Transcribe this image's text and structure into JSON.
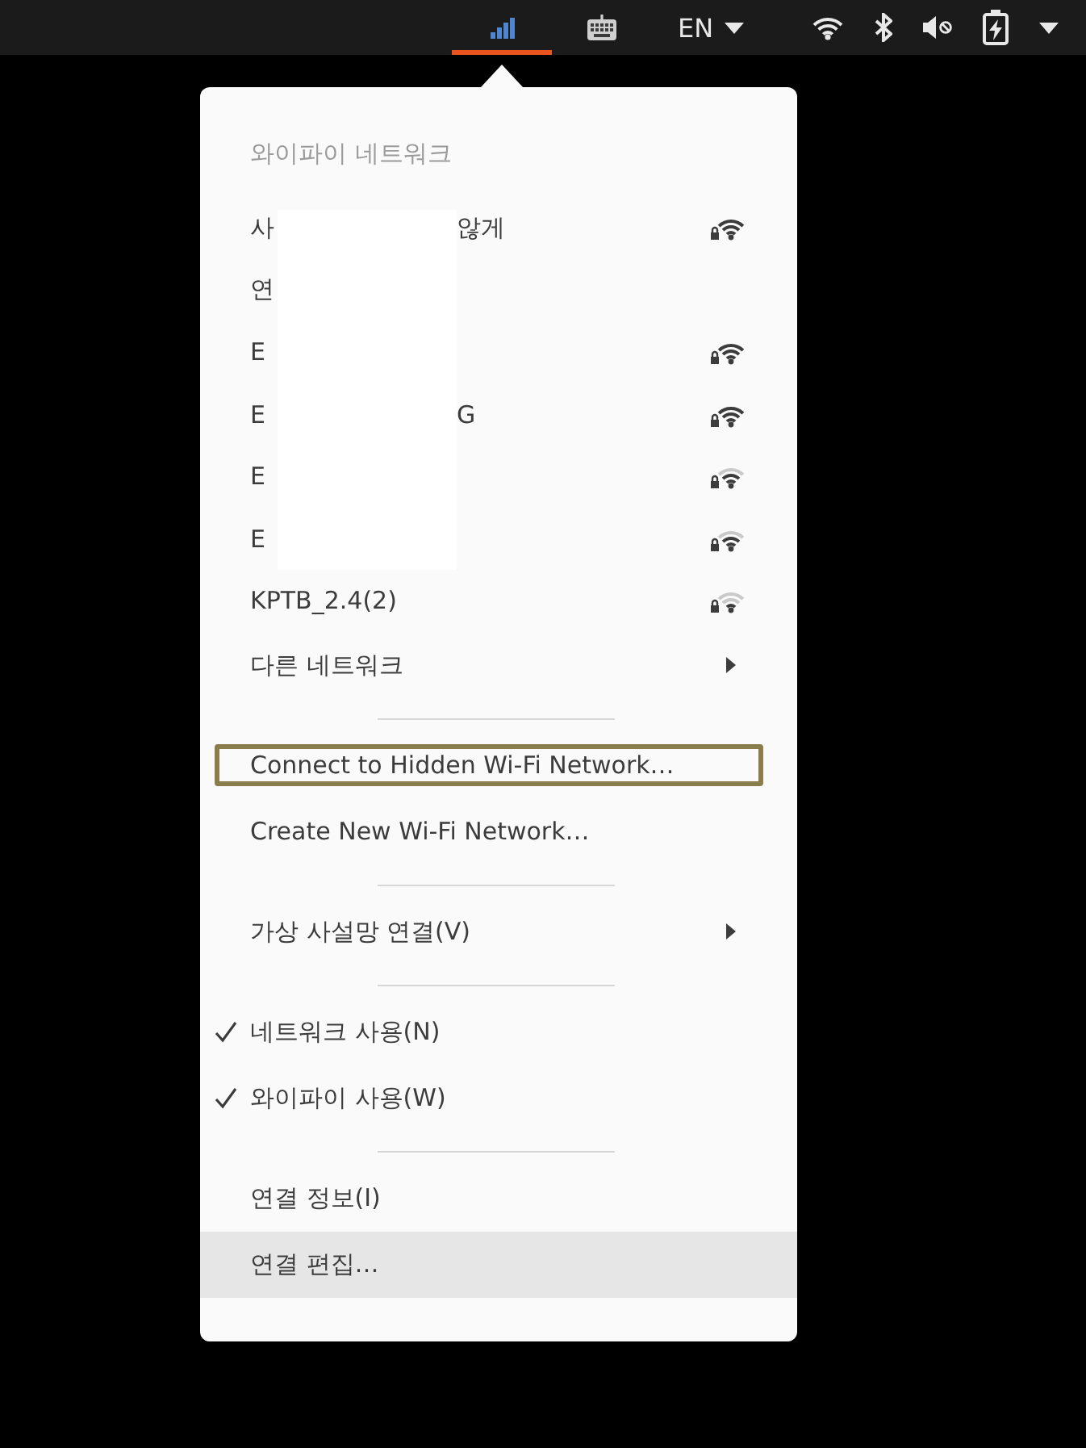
{
  "top_bar": {
    "indicators": [
      {
        "kind": "network",
        "selected": true
      },
      {
        "kind": "keyboard",
        "selected": false
      },
      {
        "kind": "language",
        "label": "EN",
        "selected": false
      },
      {
        "kind": "system",
        "selected": false
      }
    ]
  },
  "menu": {
    "title": "와이파이 네트워크",
    "networks": [
      {
        "kind": "full",
        "name_start": "사",
        "name_end": "않게",
        "redacted": true
      },
      {
        "kind": "plain",
        "name_start": "연",
        "redacted": true
      },
      {
        "kind": "full",
        "name_start": "E",
        "redacted": true
      },
      {
        "kind": "full",
        "name_start": "E",
        "name_end": "G",
        "redacted": true
      },
      {
        "kind": "good",
        "name_start": "E",
        "redacted": true
      },
      {
        "kind": "good",
        "name_start": "E",
        "redacted": true
      },
      {
        "kind": "fair",
        "name": "KPTB_2.4(2)",
        "redacted": false
      }
    ],
    "items": [
      {
        "kind": "submenu",
        "label": "다른 네트워크",
        "hovered": false,
        "outlined": false
      },
      {
        "kind": "separator"
      },
      {
        "kind": "action",
        "label": "Connect to Hidden Wi-Fi Network…",
        "hovered": false,
        "outlined": true
      },
      {
        "kind": "action",
        "label": "Create New Wi-Fi Network…",
        "hovered": false,
        "outlined": false
      },
      {
        "kind": "separator"
      },
      {
        "kind": "submenu",
        "label": "가상 사설망 연결(V)",
        "hovered": false,
        "outlined": false
      },
      {
        "kind": "separator"
      },
      {
        "kind": "toggle",
        "label": "네트워크 사용(N)",
        "checked": true,
        "hovered": false,
        "outlined": false
      },
      {
        "kind": "toggle",
        "label": "와이파이 사용(W)",
        "checked": true,
        "hovered": false,
        "outlined": false
      },
      {
        "kind": "separator"
      },
      {
        "kind": "action",
        "label": "연결 정보(I)",
        "hovered": false,
        "outlined": false
      },
      {
        "kind": "action",
        "label": "연결 편집…",
        "hovered": true,
        "outlined": false
      }
    ]
  }
}
